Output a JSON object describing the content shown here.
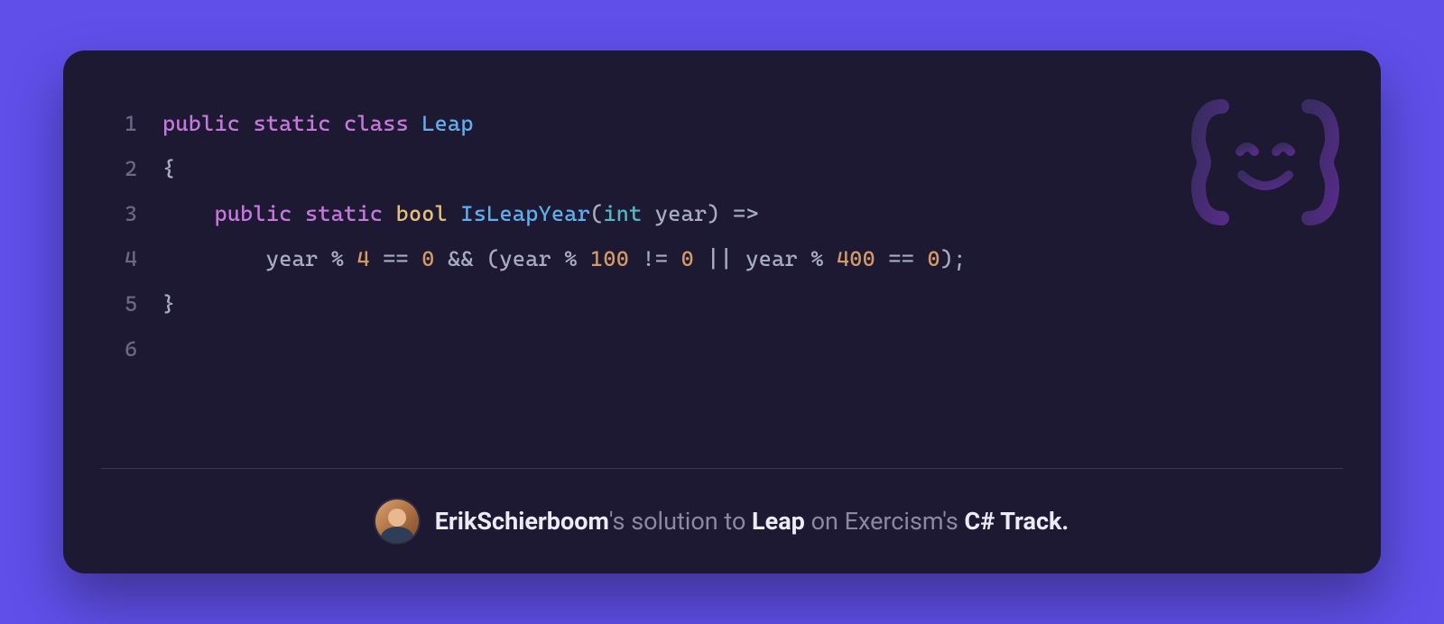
{
  "code": {
    "lines": [
      {
        "n": "1",
        "tokens": [
          {
            "t": "public",
            "c": "tk-kw"
          },
          {
            "t": " ",
            "c": "tk-def"
          },
          {
            "t": "static",
            "c": "tk-kw"
          },
          {
            "t": " ",
            "c": "tk-def"
          },
          {
            "t": "class",
            "c": "tk-kw"
          },
          {
            "t": " ",
            "c": "tk-def"
          },
          {
            "t": "Leap",
            "c": "tk-cls"
          }
        ]
      },
      {
        "n": "2",
        "tokens": [
          {
            "t": "{",
            "c": "tk-pun"
          }
        ]
      },
      {
        "n": "3",
        "tokens": [
          {
            "t": "    ",
            "c": "tk-def"
          },
          {
            "t": "public",
            "c": "tk-kw"
          },
          {
            "t": " ",
            "c": "tk-def"
          },
          {
            "t": "static",
            "c": "tk-kw"
          },
          {
            "t": " ",
            "c": "tk-def"
          },
          {
            "t": "bool",
            "c": "tk-type"
          },
          {
            "t": " ",
            "c": "tk-def"
          },
          {
            "t": "IsLeapYear",
            "c": "tk-fn"
          },
          {
            "t": "(",
            "c": "tk-pun"
          },
          {
            "t": "int",
            "c": "tk-built"
          },
          {
            "t": " ",
            "c": "tk-def"
          },
          {
            "t": "year",
            "c": "tk-prm"
          },
          {
            "t": ")",
            "c": "tk-pun"
          },
          {
            "t": " ",
            "c": "tk-def"
          },
          {
            "t": "=>",
            "c": "tk-op"
          }
        ]
      },
      {
        "n": "4",
        "tokens": [
          {
            "t": "        ",
            "c": "tk-def"
          },
          {
            "t": "year",
            "c": "tk-prm"
          },
          {
            "t": " % ",
            "c": "tk-op"
          },
          {
            "t": "4",
            "c": "tk-num"
          },
          {
            "t": " == ",
            "c": "tk-op"
          },
          {
            "t": "0",
            "c": "tk-num"
          },
          {
            "t": " && (",
            "c": "tk-op"
          },
          {
            "t": "year",
            "c": "tk-prm"
          },
          {
            "t": " % ",
            "c": "tk-op"
          },
          {
            "t": "100",
            "c": "tk-num"
          },
          {
            "t": " != ",
            "c": "tk-op"
          },
          {
            "t": "0",
            "c": "tk-num"
          },
          {
            "t": " || ",
            "c": "tk-op"
          },
          {
            "t": "year",
            "c": "tk-prm"
          },
          {
            "t": " % ",
            "c": "tk-op"
          },
          {
            "t": "400",
            "c": "tk-num"
          },
          {
            "t": " == ",
            "c": "tk-op"
          },
          {
            "t": "0",
            "c": "tk-num"
          },
          {
            "t": ");",
            "c": "tk-pun"
          }
        ]
      },
      {
        "n": "5",
        "tokens": [
          {
            "t": "}",
            "c": "tk-pun"
          }
        ]
      },
      {
        "n": "6",
        "tokens": [
          {
            "t": "",
            "c": "tk-def"
          }
        ]
      }
    ]
  },
  "footer": {
    "user": "ErikSchierboom",
    "apostrophe_s1": "'s ",
    "text1": "solution to ",
    "exercise": "Leap",
    "text2": " on ",
    "platform": "Exercism",
    "apostrophe_s2": "'s ",
    "track": "C# Track."
  }
}
